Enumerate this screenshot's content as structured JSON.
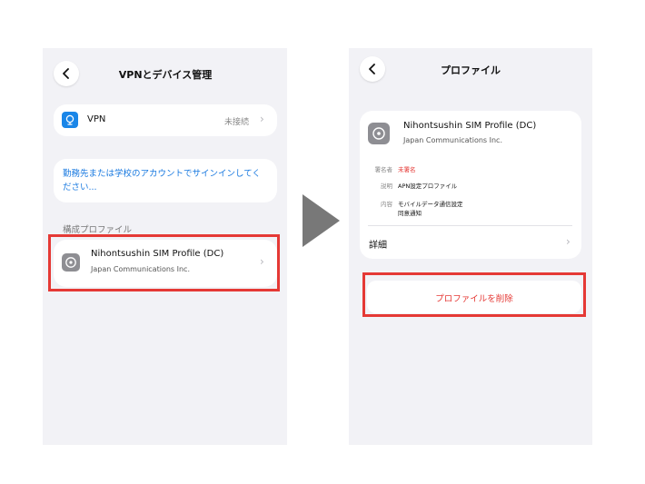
{
  "left_screen": {
    "nav_title": "VPNとデバイス管理",
    "vpn_label": "VPN",
    "vpn_status": "未接続",
    "signin_link": "勤務先または学校のアカウントでサインインしてください...",
    "section_header": "構成プロファイル",
    "profile": {
      "name": "Nihontsushin SIM Profile (DC)",
      "org": "Japan Communications Inc."
    }
  },
  "right_screen": {
    "nav_title": "プロファイル",
    "profile": {
      "name": "Nihontsushin SIM Profile (DC)",
      "org": "Japan Communications Inc."
    },
    "details": {
      "signer_label": "署名者",
      "signer_value": "未署名",
      "desc_label": "説明",
      "desc_value": "APN設定プロファイル",
      "contents_label": "内容",
      "contents_line1": "モバイルデータ通信設定",
      "contents_line2": "同意通知"
    },
    "more_details": "詳細",
    "delete_button": "プロファイルを削除"
  },
  "colors": {
    "highlight_red": "#e53935",
    "link_blue": "#1a7ae0",
    "destructive_red": "#e53935",
    "background": "#f2f2f6"
  },
  "icons": [
    "chevron-left-icon",
    "vpn-globe-icon",
    "gear-icon",
    "chevron-right-icon",
    "play-arrow-icon"
  ]
}
